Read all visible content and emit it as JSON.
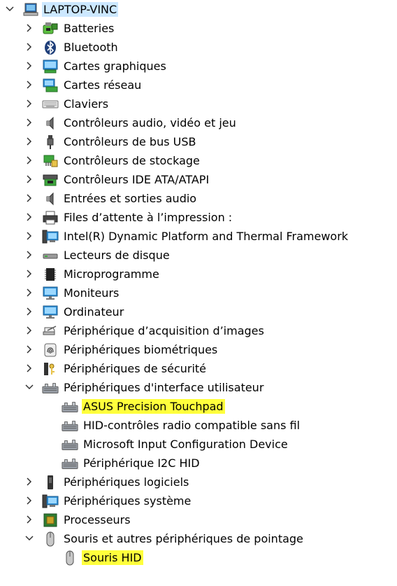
{
  "window": {
    "root": {
      "label": "LAPTOP-VINC",
      "icon": "computer-icon",
      "expanded": true
    }
  },
  "colors": {
    "selection": "#cce8ff",
    "highlight": "#ffff3c",
    "chevron": "#333333"
  },
  "tree": [
    {
      "label": "Batteries",
      "icon": "battery-icon",
      "expanded": false
    },
    {
      "label": "Bluetooth",
      "icon": "bluetooth-icon",
      "expanded": false
    },
    {
      "label": "Cartes graphiques",
      "icon": "display-adapter-icon",
      "expanded": false
    },
    {
      "label": "Cartes réseau",
      "icon": "network-adapter-icon",
      "expanded": false
    },
    {
      "label": "Claviers",
      "icon": "keyboard-icon",
      "expanded": false
    },
    {
      "label": "Contrôleurs audio, vidéo et jeu",
      "icon": "speaker-icon",
      "expanded": false
    },
    {
      "label": "Contrôleurs de bus USB",
      "icon": "usb-icon",
      "expanded": false
    },
    {
      "label": "Contrôleurs de stockage",
      "icon": "storage-controller-icon",
      "expanded": false
    },
    {
      "label": "Contrôleurs IDE ATA/ATAPI",
      "icon": "ide-controller-icon",
      "expanded": false
    },
    {
      "label": "Entrées et sorties audio",
      "icon": "speaker-icon",
      "expanded": false
    },
    {
      "label": "Files d’attente à l’impression :",
      "icon": "printer-icon",
      "expanded": false
    },
    {
      "label": "Intel(R) Dynamic Platform and Thermal Framework",
      "icon": "system-device-icon",
      "expanded": false
    },
    {
      "label": "Lecteurs de disque",
      "icon": "disk-drive-icon",
      "expanded": false
    },
    {
      "label": "Microprogramme",
      "icon": "chip-icon",
      "expanded": false
    },
    {
      "label": "Moniteurs",
      "icon": "monitor-icon",
      "expanded": false
    },
    {
      "label": "Ordinateur",
      "icon": "monitor-icon",
      "expanded": false
    },
    {
      "label": "Périphérique d’acquisition d’images",
      "icon": "camera-icon",
      "expanded": false
    },
    {
      "label": "Périphériques biométriques",
      "icon": "fingerprint-icon",
      "expanded": false
    },
    {
      "label": "Périphériques de sécurité",
      "icon": "security-key-icon",
      "expanded": false
    },
    {
      "label": "Périphériques d'interface utilisateur",
      "icon": "hid-icon",
      "expanded": true,
      "children": [
        {
          "label": "ASUS Precision Touchpad",
          "icon": "hid-icon",
          "highlight": true
        },
        {
          "label": "HID-contrôles radio compatible sans fil",
          "icon": "hid-icon",
          "highlight": false
        },
        {
          "label": "Microsoft Input Configuration Device",
          "icon": "hid-icon",
          "highlight": false
        },
        {
          "label": "Périphérique I2C HID",
          "icon": "hid-icon",
          "highlight": false
        }
      ]
    },
    {
      "label": "Périphériques logiciels",
      "icon": "software-device-icon",
      "expanded": false
    },
    {
      "label": "Périphériques système",
      "icon": "system-device-icon",
      "expanded": false
    },
    {
      "label": "Processeurs",
      "icon": "processor-icon",
      "expanded": false
    },
    {
      "label": "Souris et autres périphériques de pointage",
      "icon": "mouse-icon",
      "expanded": true,
      "children": [
        {
          "label": "Souris HID",
          "icon": "mouse-icon",
          "highlight": true
        }
      ]
    }
  ]
}
